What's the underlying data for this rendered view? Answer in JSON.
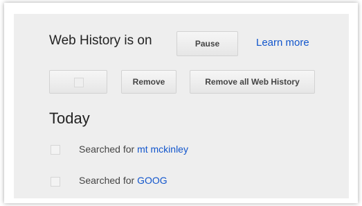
{
  "history": {
    "status_text": "Web History is on",
    "pause_label": "Pause",
    "learn_more_label": "Learn more",
    "remove_label": "Remove",
    "remove_all_label": "Remove all Web History",
    "section_heading": "Today",
    "items": [
      {
        "prefix": "Searched for",
        "query": "mt mckinley"
      },
      {
        "prefix": "Searched for",
        "query": "GOOG"
      }
    ]
  },
  "colors": {
    "panel_background": "#eeeeee",
    "link": "#1155cc",
    "text": "#222222"
  },
  "icons": {
    "select_all": "checkbox-icon"
  }
}
